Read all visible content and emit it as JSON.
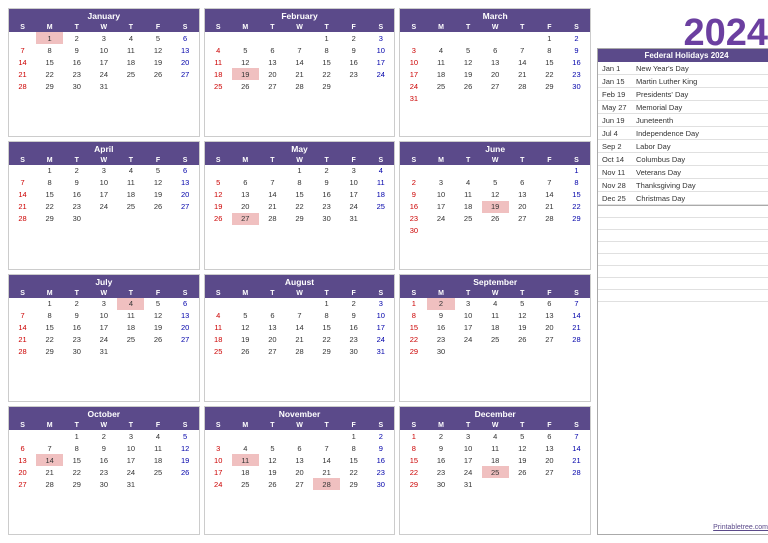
{
  "year": "2024",
  "months": [
    {
      "name": "January",
      "startDay": 1,
      "days": 31,
      "holidays": [
        1
      ]
    },
    {
      "name": "February",
      "startDay": 4,
      "days": 29,
      "holidays": [
        19
      ]
    },
    {
      "name": "March",
      "startDay": 5,
      "days": 31,
      "holidays": []
    },
    {
      "name": "April",
      "startDay": 1,
      "days": 30,
      "holidays": []
    },
    {
      "name": "May",
      "startDay": 3,
      "days": 31,
      "holidays": [
        27
      ]
    },
    {
      "name": "June",
      "startDay": 6,
      "days": 30,
      "holidays": [
        19
      ]
    },
    {
      "name": "July",
      "startDay": 1,
      "days": 31,
      "holidays": [
        4
      ]
    },
    {
      "name": "August",
      "startDay": 4,
      "days": 31,
      "holidays": []
    },
    {
      "name": "September",
      "startDay": 0,
      "days": 30,
      "holidays": [
        2
      ]
    },
    {
      "name": "October",
      "startDay": 2,
      "days": 31,
      "holidays": [
        14
      ]
    },
    {
      "name": "November",
      "startDay": 5,
      "days": 30,
      "holidays": [
        11,
        28
      ]
    },
    {
      "name": "December",
      "startDay": 0,
      "days": 31,
      "holidays": [
        25
      ]
    }
  ],
  "dayHeaders": [
    "S",
    "M",
    "T",
    "W",
    "T",
    "F",
    "S"
  ],
  "federalHolidays": {
    "title": "Federal Holidays 2024",
    "items": [
      {
        "date": "Jan 1",
        "name": "New Year's Day"
      },
      {
        "date": "Jan 15",
        "name": "Martin Luther King"
      },
      {
        "date": "Feb 19",
        "name": "Presidents' Day"
      },
      {
        "date": "May 27",
        "name": "Memorial Day"
      },
      {
        "date": "Jun 19",
        "name": "Juneteenth"
      },
      {
        "date": "Jul 4",
        "name": "Independence Day"
      },
      {
        "date": "Sep 2",
        "name": "Labor Day"
      },
      {
        "date": "Oct 14",
        "name": "Columbus Day"
      },
      {
        "date": "Nov 11",
        "name": "Veterans Day"
      },
      {
        "date": "Nov 28",
        "name": "Thanksgiving Day"
      },
      {
        "date": "Dec 25",
        "name": "Christmas Day"
      }
    ]
  },
  "watermark": "Printabletree.com"
}
